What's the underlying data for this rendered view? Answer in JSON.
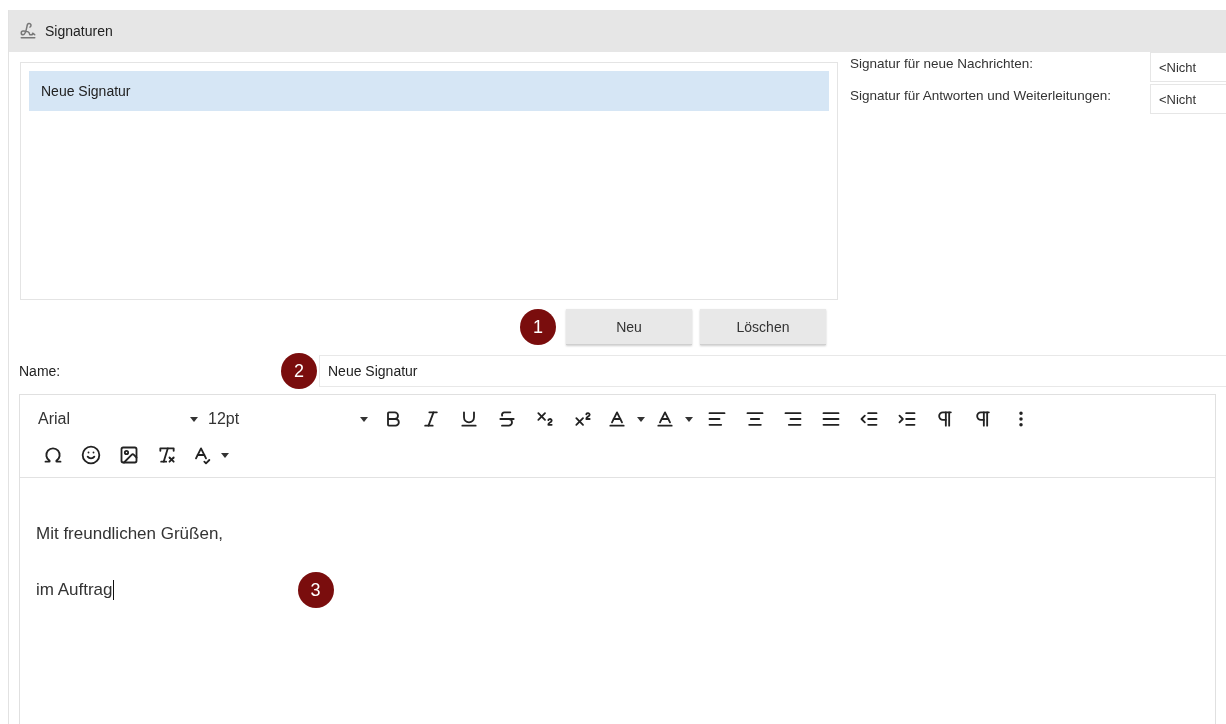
{
  "panel": {
    "title": "Signaturen"
  },
  "signatures": [
    {
      "label": "Neue Signatur",
      "selected": true
    }
  ],
  "defaults": [
    {
      "label": "Signatur für neue Nachrichten:",
      "value": "<Nicht"
    },
    {
      "label": "Signatur für Antworten und Weiterleitungen:",
      "value": "<Nicht"
    }
  ],
  "buttons": [
    {
      "label": "Neu",
      "badge": "1"
    },
    {
      "label": "Löschen"
    }
  ],
  "name_field": {
    "label": "Name:",
    "badge": "2",
    "value": "Neue Signatur"
  },
  "editor": {
    "font": "Arial",
    "size": "12pt",
    "lines": [
      "Mit freundlichen Grüßen,",
      "im Auftrag"
    ],
    "badge": "3",
    "caret": true
  }
}
